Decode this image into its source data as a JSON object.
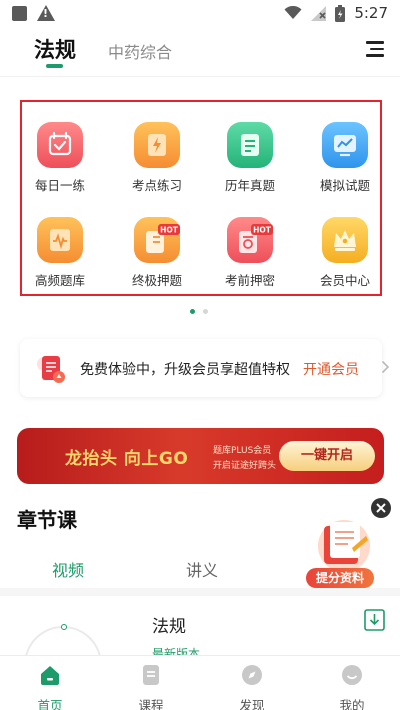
{
  "status_bar": {
    "time": "5:27"
  },
  "header": {
    "active_tab": "法规",
    "second_tab": "中药综合"
  },
  "grid": {
    "items": [
      {
        "label": "每日一练",
        "icon": "calendar-check-icon",
        "color": "#f2606a"
      },
      {
        "label": "考点练习",
        "icon": "bolt-note-icon",
        "color": "#f59a3c"
      },
      {
        "label": "历年真题",
        "icon": "document-icon",
        "color": "#35c48a"
      },
      {
        "label": "模拟试题",
        "icon": "monitor-chart-icon",
        "color": "#3ba8f2"
      },
      {
        "label": "高频题库",
        "icon": "pulse-book-icon",
        "color": "#f59a3c"
      },
      {
        "label": "终极押题",
        "icon": "hot-bolt-icon",
        "color": "#f59a3c",
        "badge": "HOT"
      },
      {
        "label": "考前押密",
        "icon": "hot-lock-icon",
        "color": "#f2606a",
        "badge": "HOT"
      },
      {
        "label": "会员中心",
        "icon": "crown-icon",
        "color": "#f7b731"
      }
    ]
  },
  "pager": {
    "active_color": "#1e9b6a",
    "inactive_color": "#d6d6d6"
  },
  "promo": {
    "text": "免费体验中，升级会员享超值特权",
    "link": "开通会员"
  },
  "banner": {
    "title": "龙抬头 向上GO",
    "sub1": "题库PLUS会员",
    "sub2": "开启证途好跨头",
    "button": "一键开启"
  },
  "chapter": {
    "title": "章节课",
    "tabs": [
      "视频",
      "讲义"
    ],
    "course_title": "法规",
    "course_sub": "最新版本"
  },
  "float": {
    "label": "提分资料"
  },
  "bottom_nav": {
    "items": [
      {
        "label": "首页",
        "icon": "home-icon",
        "active": true
      },
      {
        "label": "课程",
        "icon": "course-icon",
        "active": false
      },
      {
        "label": "发现",
        "icon": "compass-icon",
        "active": false
      },
      {
        "label": "我的",
        "icon": "profile-icon",
        "active": false
      }
    ]
  },
  "colors": {
    "accent": "#1e9b6a",
    "highlight_box": "#e0252e",
    "link": "#e05a30"
  }
}
